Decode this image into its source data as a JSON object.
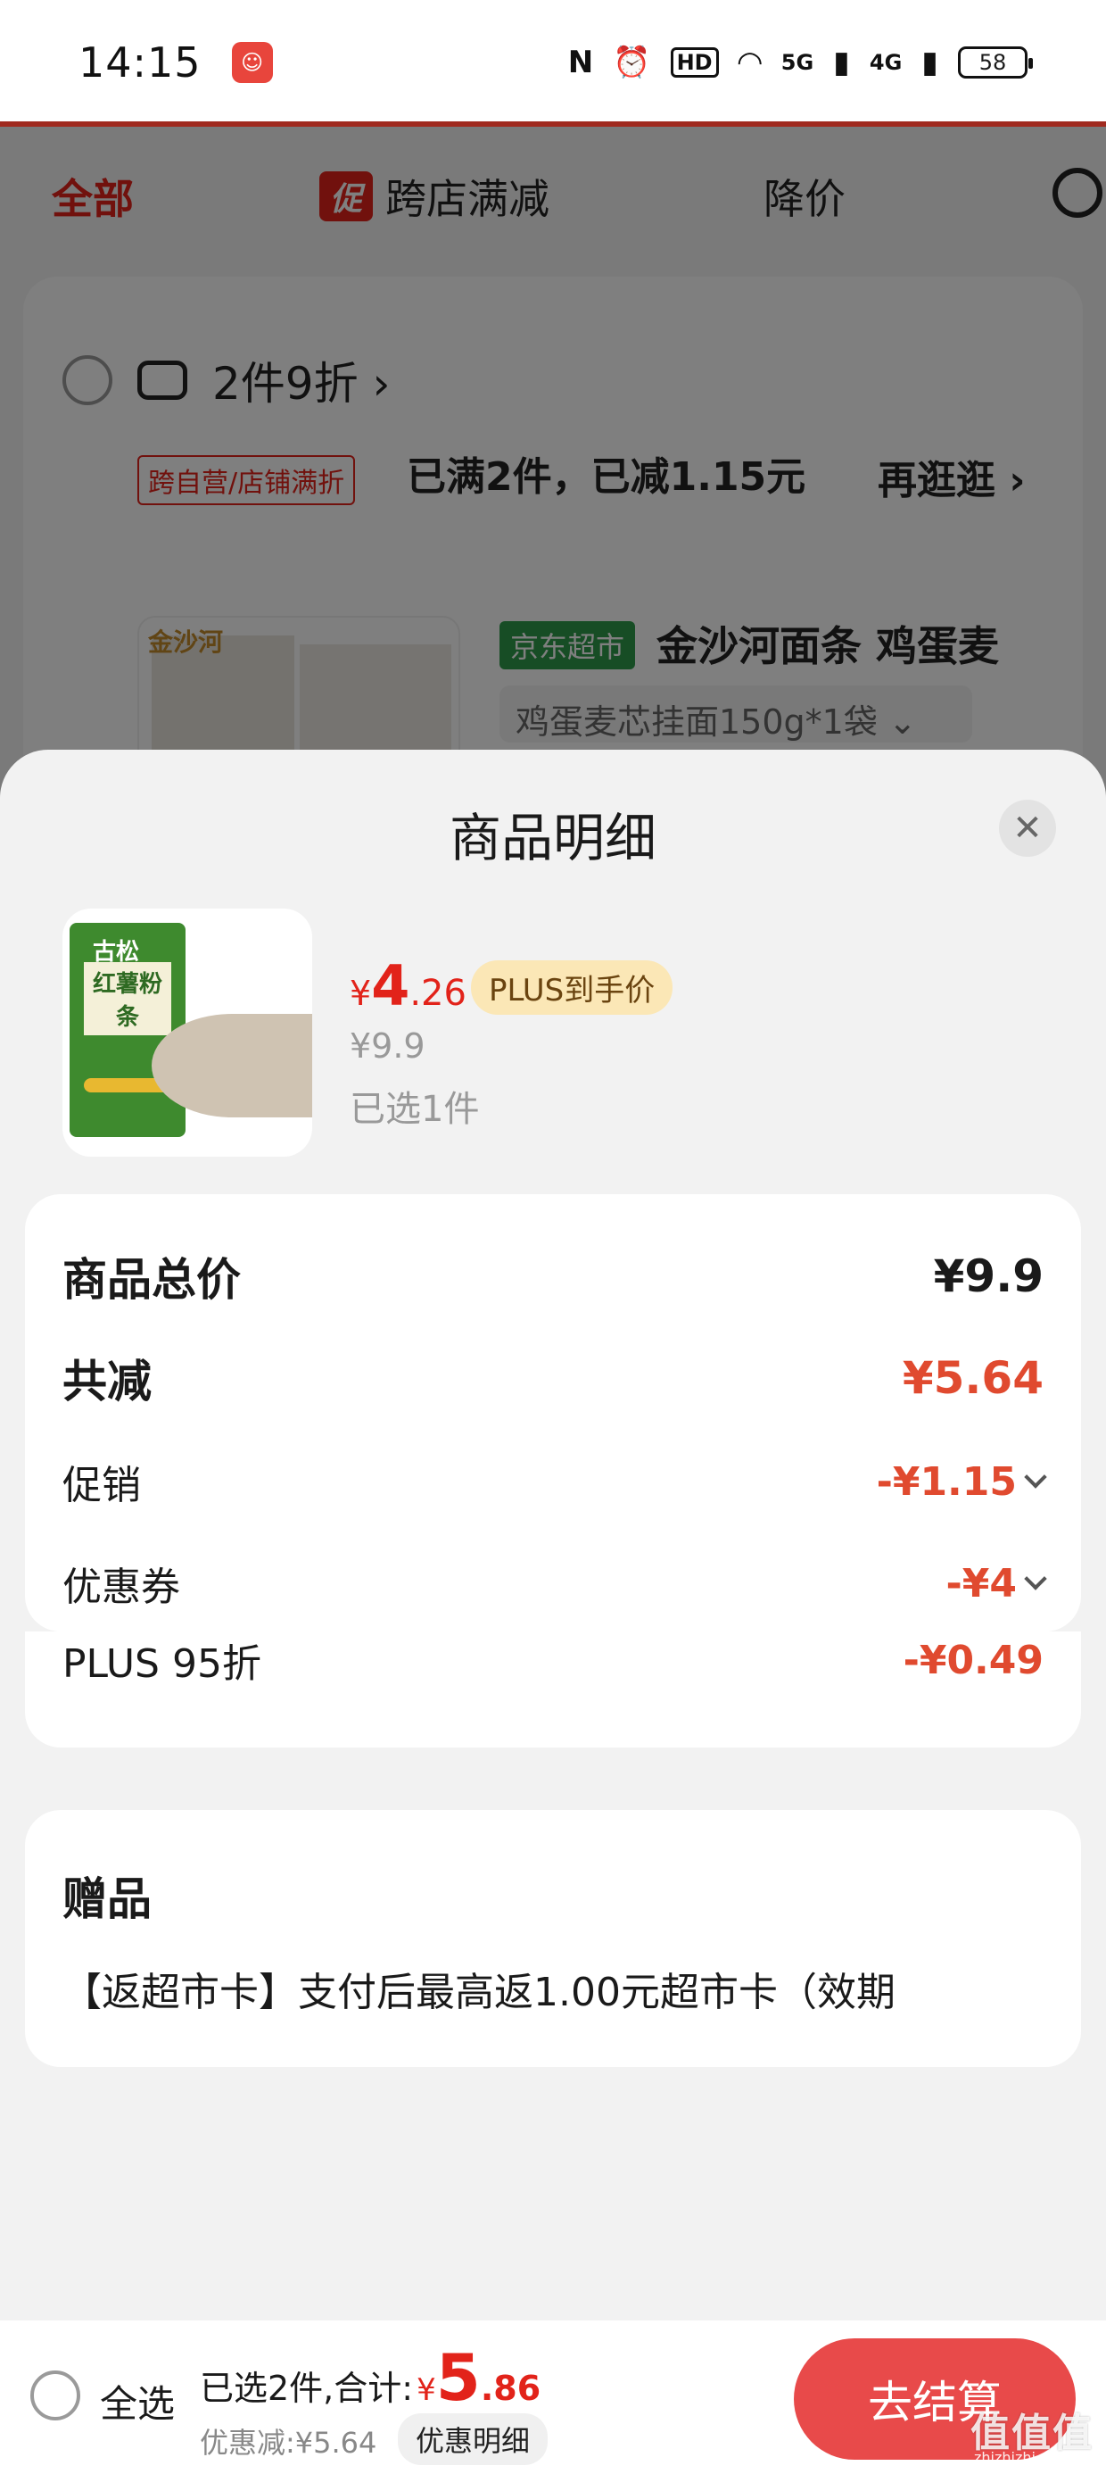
{
  "status_bar": {
    "time": "14:15",
    "app_icon": "red-app-icon",
    "nfc": "N",
    "alarm": "⏰",
    "hd": "HD",
    "wifi": "wifi",
    "signal_5g": "5G",
    "signal_4g": "4G",
    "battery": "58"
  },
  "filter_bar": {
    "all": "全部",
    "promo_badge": "促",
    "promo_label": "跨店满减",
    "price_drop": "降价"
  },
  "store": {
    "title": "2件9折",
    "chevron": "›",
    "cross_badge": "跨自营/店铺满折",
    "cross_text": "已满2件，已减1.15元",
    "more": "再逛逛 ›",
    "product": {
      "thumb_logo": "金沙河",
      "store_badge": "京东超市",
      "title": "金沙河面条 鸡蛋麦",
      "sku": "鸡蛋麦芯挂面150g*1袋 ⌄"
    }
  },
  "sheet": {
    "title": "商品明细",
    "item": {
      "pack_brand": "古松",
      "pack_label": "红薯粉条",
      "price_currency": "¥",
      "price_int": "4",
      "price_dec": ".26",
      "plus_tag": "PLUS到手价",
      "original_price": "¥9.9",
      "selected_qty": "已选1件"
    },
    "calc": {
      "total_label": "商品总价",
      "total_value": "¥9.9",
      "reduce_label": "共减",
      "reduce_value": "¥5.64",
      "promo_label": "促销",
      "promo_value": "-¥1.15",
      "coupon_label": "优惠券",
      "coupon_value": "-¥4",
      "plus_label": "PLUS 95折",
      "plus_value": "-¥0.49"
    },
    "gift": {
      "title": "赠品",
      "text": "【返超市卡】支付后最高返1.00元超市卡（效期"
    }
  },
  "bottom_bar": {
    "select_all": "全选",
    "total_label": "已选2件,合计:",
    "total_currency": "¥",
    "total_int": "5",
    "total_dec": ".86",
    "discount": "优惠减:¥5.64",
    "detail_button": "优惠明细",
    "checkout": "去结算"
  },
  "watermark": {
    "main": "值值值",
    "sub": "zhizhizhi.com"
  },
  "colors": {
    "accent_red": "#e2231a",
    "checkout_red": "#e84a4a",
    "plus_gold": "#fbe7b6",
    "jd_green": "#2e9b4a"
  }
}
